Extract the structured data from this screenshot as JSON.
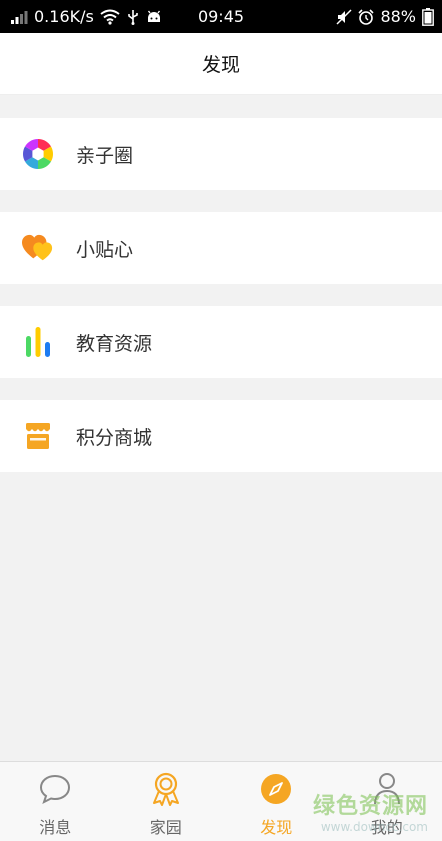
{
  "statusbar": {
    "speed": "0.16K/s",
    "time": "09:45",
    "battery": "88%"
  },
  "header": {
    "title": "发现"
  },
  "menu": [
    {
      "label": "亲子圈",
      "icon": "camera-aperture-icon"
    },
    {
      "label": "小贴心",
      "icon": "hearts-icon"
    },
    {
      "label": "教育资源",
      "icon": "bar-chart-icon"
    },
    {
      "label": "积分商城",
      "icon": "shop-icon"
    }
  ],
  "tabs": [
    {
      "label": "消息",
      "icon": "chat-bubble-icon",
      "active": false
    },
    {
      "label": "家园",
      "icon": "medal-icon",
      "active": false
    },
    {
      "label": "发现",
      "icon": "compass-icon",
      "active": true
    },
    {
      "label": "我的",
      "icon": "user-icon",
      "active": false
    }
  ],
  "colors": {
    "accent": "#f5a623",
    "inactive": "#888888",
    "status_bar": "#000000"
  },
  "watermark": {
    "main": "绿色资源网",
    "sub": "www.downcc.com"
  }
}
